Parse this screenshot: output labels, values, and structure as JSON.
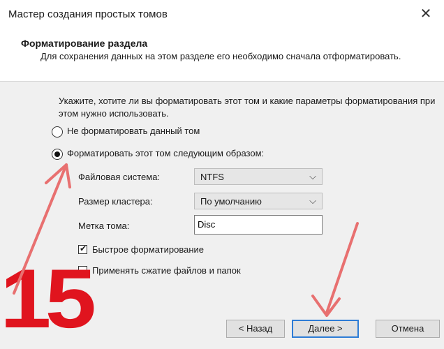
{
  "window": {
    "title": "Мастер создания простых томов"
  },
  "header": {
    "title": "Форматирование раздела",
    "subtitle": "Для сохранения данных на этом разделе его необходимо сначала отформатировать."
  },
  "intro": "Укажите, хотите ли вы форматировать этот том и какие параметры форматирования при этом нужно использовать.",
  "options": {
    "no_format": {
      "label": "Не форматировать данный том",
      "selected": false
    },
    "format": {
      "label": "Форматировать этот том следующим образом:",
      "selected": true
    }
  },
  "fields": {
    "fs_label": "Файловая система:",
    "fs_value": "NTFS",
    "cluster_label": "Размер кластера:",
    "cluster_value": "По умолчанию",
    "volume_label": "Метка тома:",
    "volume_value": "Disc"
  },
  "checkboxes": {
    "quick_format": {
      "label": "Быстрое форматирование",
      "checked": true
    },
    "compress": {
      "label": "Применять сжатие файлов и папок",
      "checked": false
    }
  },
  "buttons": {
    "back": "< Назад",
    "next": "Далее >",
    "cancel": "Отмена"
  },
  "annotation": {
    "step_number": "15",
    "color": "#e0141e"
  },
  "colors": {
    "accent": "#2d7cd6"
  }
}
